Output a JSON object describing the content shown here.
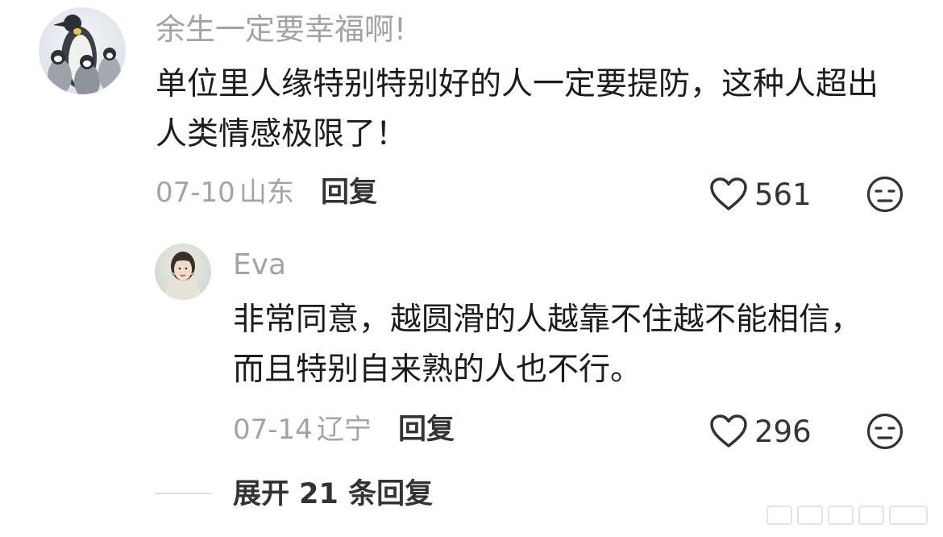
{
  "comment": {
    "username": "余生一定要幸福啊!",
    "avatar_icon": "penguin-avatar",
    "text": "单位里人缘特别特别好的人一定要提防，这种人超出人类情感极限了！",
    "date": "07-10",
    "location": "山东",
    "reply_label": "回复",
    "like_count": "561",
    "like_icon": "heart-icon",
    "dislike_icon": "meh-face-icon"
  },
  "reply": {
    "username": "Eva",
    "avatar_icon": "woman-portrait-avatar",
    "text": "非常同意，越圆滑的人越靠不住越不能相信，而且特别自来熟的人也不行。",
    "date": "07-14",
    "location": "辽宁",
    "reply_label": "回复",
    "like_count": "296",
    "like_icon": "heart-icon",
    "dislike_icon": "meh-face-icon"
  },
  "expand": {
    "label": "展开 21 条回复"
  },
  "colors": {
    "text_primary": "#1c1c1c",
    "text_secondary": "#a3a3a3",
    "icon_stroke": "#333333"
  }
}
